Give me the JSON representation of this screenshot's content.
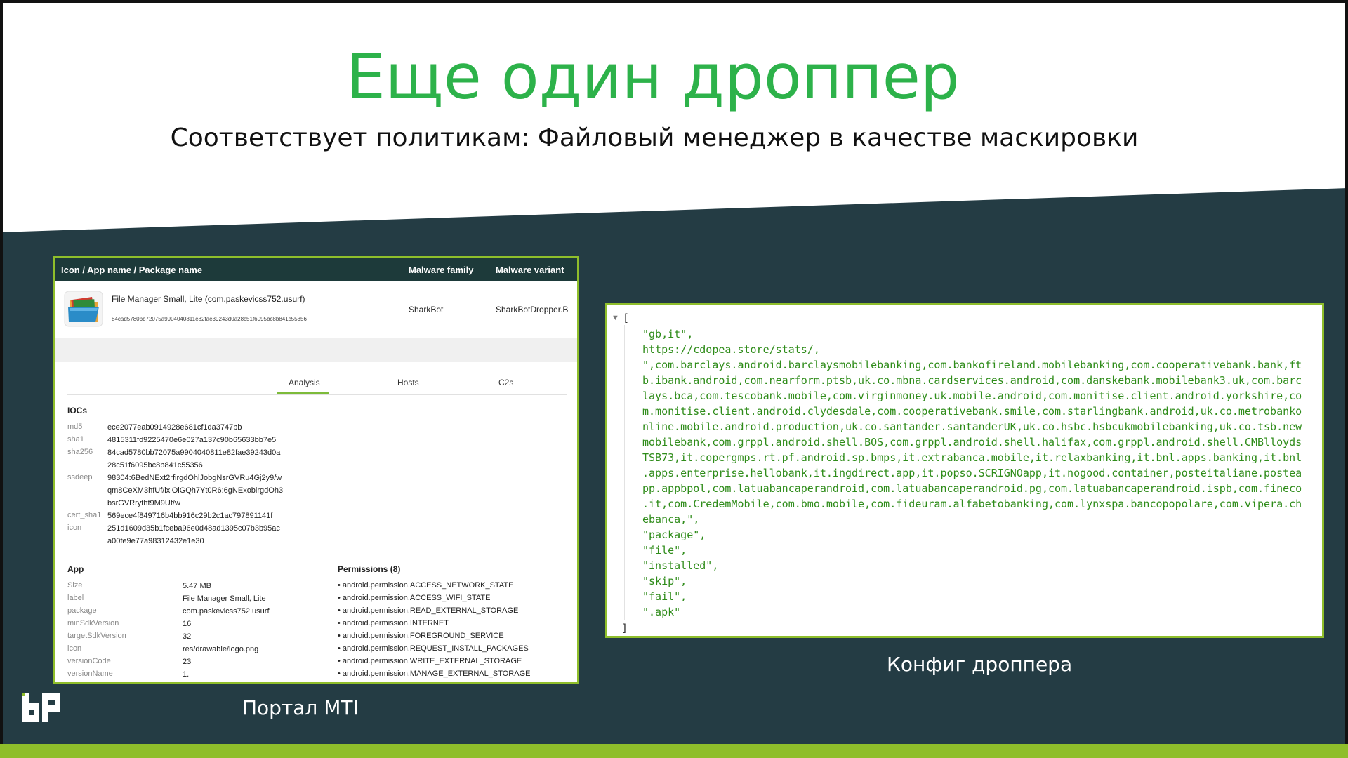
{
  "slide": {
    "title": "Еще один дроппер",
    "subtitle": "Соответствует политикам: Файловый менеджер в качестве маскировки"
  },
  "mti": {
    "headers": {
      "app": "Icon / App name / Package name",
      "family": "Malware family",
      "variant": "Malware variant"
    },
    "app": {
      "name": "File Manager Small, Lite (com.paskevicss752.usurf)",
      "hash": "84cad5780bb72075a9904040811e82fae39243d0a28c51f6095bc8b841c55356",
      "family": "SharkBot",
      "variant": "SharkBotDropper.B"
    },
    "tabs": [
      "Analysis",
      "Hosts",
      "C2s"
    ],
    "iocs": {
      "title": "IOCs",
      "rows": [
        {
          "key": "md5",
          "lines": [
            "ece2077eab0914928e681cf1da3747bb"
          ]
        },
        {
          "key": "sha1",
          "lines": [
            "4815311fd9225470e6e027a137c90b65633bb7e5"
          ]
        },
        {
          "key": "sha256",
          "lines": [
            "84cad5780bb72075a9904040811e82fae39243d0a",
            "28c51f6095bc8b841c55356"
          ]
        },
        {
          "key": "ssdeep",
          "lines": [
            "98304:6BedNExt2rfirgdOhlJobgNsrGVRu4Gj2y9/w",
            "qm8CeXM3hfUf/lxiOlGQh7Yt0R6:6gNExobirgdOh3",
            "bsrGVRrytht9M9Uf/w"
          ]
        },
        {
          "key": "cert_sha1",
          "lines": [
            "569ece4f849716b4bb916c29b2c1ac797891141f"
          ]
        },
        {
          "key": "icon",
          "lines": [
            "251d1609d35b1fceba96e0d48ad1395c07b3b95ac",
            "a00fe9e77a98312432e1e30"
          ]
        }
      ]
    },
    "app_info": {
      "title": "App",
      "rows": [
        {
          "key": "Size",
          "value": "5.47 MB"
        },
        {
          "key": "label",
          "value": "File Manager Small, Lite"
        },
        {
          "key": "package",
          "value": "com.paskevicss752.usurf"
        },
        {
          "key": "minSdkVersion",
          "value": "16"
        },
        {
          "key": "targetSdkVersion",
          "value": "32"
        },
        {
          "key": "icon",
          "value": "res/drawable/logo.png"
        },
        {
          "key": "versionCode",
          "value": "23"
        },
        {
          "key": "versionName",
          "value": "1."
        }
      ]
    },
    "permissions": {
      "title": "Permissions (8)",
      "items": [
        "android.permission.ACCESS_NETWORK_STATE",
        "android.permission.ACCESS_WIFI_STATE",
        "android.permission.READ_EXTERNAL_STORAGE",
        "android.permission.INTERNET",
        "android.permission.FOREGROUND_SERVICE",
        "android.permission.REQUEST_INSTALL_PACKAGES",
        "android.permission.WRITE_EXTERNAL_STORAGE",
        "android.permission.MANAGE_EXTERNAL_STORAGE"
      ]
    }
  },
  "config": {
    "toggle_icon": "▼",
    "open_bracket": "[",
    "close_bracket": "]",
    "lines": [
      "\"gb,it\",",
      "https://cdopea.store/stats/,",
      "\",com.barclays.android.barclaysmobilebanking,com.bankofireland.mobilebanking,com.cooperativebank.bank,ft",
      "b.ibank.android,com.nearform.ptsb,uk.co.mbna.cardservices.android,com.danskebank.mobilebank3.uk,com.barc",
      "lays.bca,com.tescobank.mobile,com.virginmoney.uk.mobile.android,com.monitise.client.android.yorkshire,co",
      "m.monitise.client.android.clydesdale,com.cooperativebank.smile,com.starlingbank.android,uk.co.metrobanko",
      "nline.mobile.android.production,uk.co.santander.santanderUK,uk.co.hsbc.hsbcukmobilebanking,uk.co.tsb.new",
      "mobilebank,com.grppl.android.shell.BOS,com.grppl.android.shell.halifax,com.grppl.android.shell.CMBlloyds",
      "TSB73,it.copergmps.rt.pf.android.sp.bmps,it.extrabanca.mobile,it.relaxbanking,it.bnl.apps.banking,it.bnl",
      ".apps.enterprise.hellobank,it.ingdirect.app,it.popso.SCRIGNOapp,it.nogood.container,posteitaliane.postea",
      "pp.appbpol,com.latuabancaperandroid,com.latuabancaperandroid.pg,com.latuabancaperandroid.ispb,com.fineco",
      ".it,com.CredemMobile,com.bmo.mobile,com.fideuram.alfabetobanking,com.lynxspa.bancopopolare,com.vipera.ch",
      "ebanca,\",",
      "\"package\",",
      "\"file\",",
      "\"installed\",",
      "\"skip\",",
      "\"fail\",",
      "\".apk\""
    ]
  },
  "captions": {
    "mti": "Портал MTI",
    "config": "Конфиг дроппера"
  },
  "colors": {
    "title": "#2db24a",
    "band": "#243c44",
    "accent": "#8fbe2b",
    "code": "#2f8c1a"
  },
  "icons": {
    "app": "folder-icon",
    "logo": "brand-logo-icon"
  }
}
